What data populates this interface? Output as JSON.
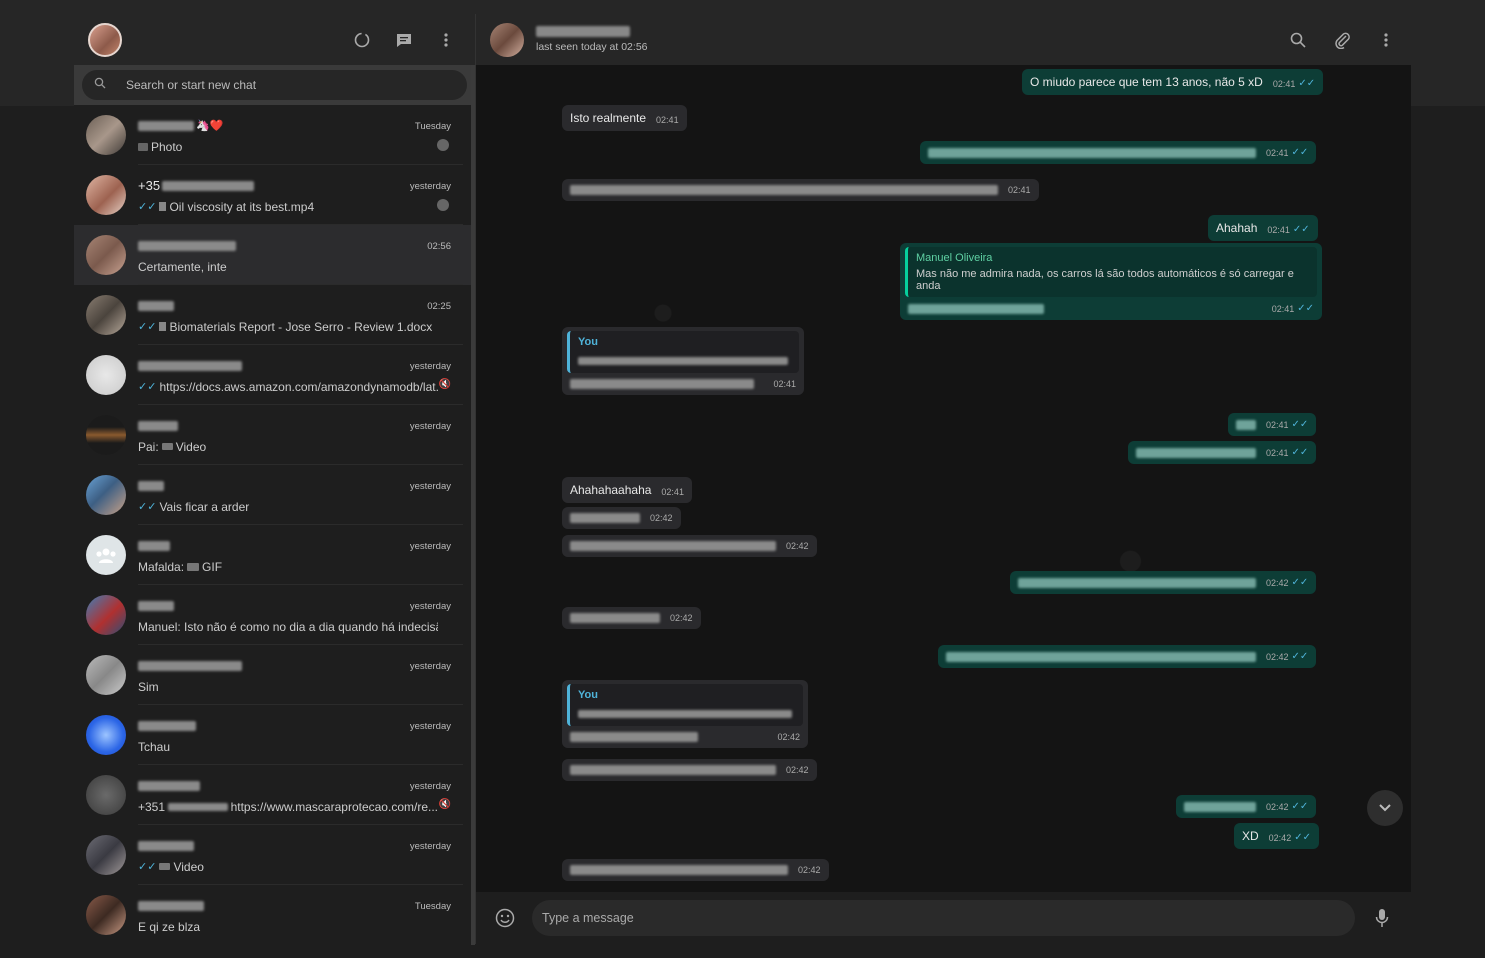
{
  "sidebar": {
    "search_placeholder": "Search or start new chat",
    "chats": [
      {
        "time": "Tuesday",
        "preview": "Photo",
        "emoji": "🦄❤️"
      },
      {
        "name_prefix": "+35",
        "time": "yesterday",
        "preview": "Oil viscosity at its best.mp4"
      },
      {
        "time": "02:56",
        "preview": "Certamente, inte"
      },
      {
        "time": "02:25",
        "preview": "Biomaterials Report - Jose Serro - Review 1.docx"
      },
      {
        "time": "yesterday",
        "preview": "https://docs.aws.amazon.com/amazondynamodb/lat..."
      },
      {
        "time": "yesterday",
        "preview_prefix": "Pai:",
        "preview": "Video"
      },
      {
        "time": "yesterday",
        "preview": "Vais ficar a arder"
      },
      {
        "time": "yesterday",
        "preview_prefix": "Mafalda:",
        "preview": "GIF"
      },
      {
        "time": "yesterday",
        "preview": "Manuel: Isto não é como no dia a dia quando há indecisão ..."
      },
      {
        "time": "yesterday",
        "preview": "Sim"
      },
      {
        "time": "yesterday",
        "preview": "Tchau"
      },
      {
        "time": "yesterday",
        "preview_prefix": "+351",
        "preview": "https://www.mascaraprotecao.com/re..."
      },
      {
        "time": "yesterday",
        "preview": "Video"
      },
      {
        "time": "Tuesday",
        "preview": "E qi ze blza"
      }
    ]
  },
  "header": {
    "last_seen": "last seen today at 02:56"
  },
  "messages": [
    {
      "text": "O miudo parece que tem 13 anos, não 5 xD",
      "time": "02:41"
    },
    {
      "text": "Isto realmente",
      "time": "02:41"
    },
    {
      "time": "02:41"
    },
    {
      "time": "02:41"
    },
    {
      "text": "Ahahah",
      "time": "02:41"
    },
    {
      "quote_author": "Manuel Oliveira",
      "quote_text": "Mas não me admira nada, os carros lá são todos automáticos é só carregar e anda",
      "time": "02:41"
    },
    {
      "quote_author": "You",
      "time": "02:41"
    },
    {
      "time": "02:41"
    },
    {
      "time": "02:41"
    },
    {
      "text": "Ahahahaahaha",
      "time": "02:41"
    },
    {
      "time": "02:42"
    },
    {
      "time": "02:42"
    },
    {
      "time": "02:42"
    },
    {
      "time": "02:42"
    },
    {
      "time": "02:42"
    },
    {
      "quote_author": "You",
      "time": "02:42"
    },
    {
      "time": "02:42"
    },
    {
      "time": "02:42"
    },
    {
      "text": "XD",
      "time": "02:42"
    },
    {
      "time": "02:42"
    }
  ],
  "composer": {
    "placeholder": "Type a message"
  },
  "colors": {
    "incoming_bubble": "#2a2a2d",
    "outgoing_bubble": "#0d3d36",
    "tick_blue": "#4fb3d9",
    "quote_green": "#06cf9c"
  }
}
